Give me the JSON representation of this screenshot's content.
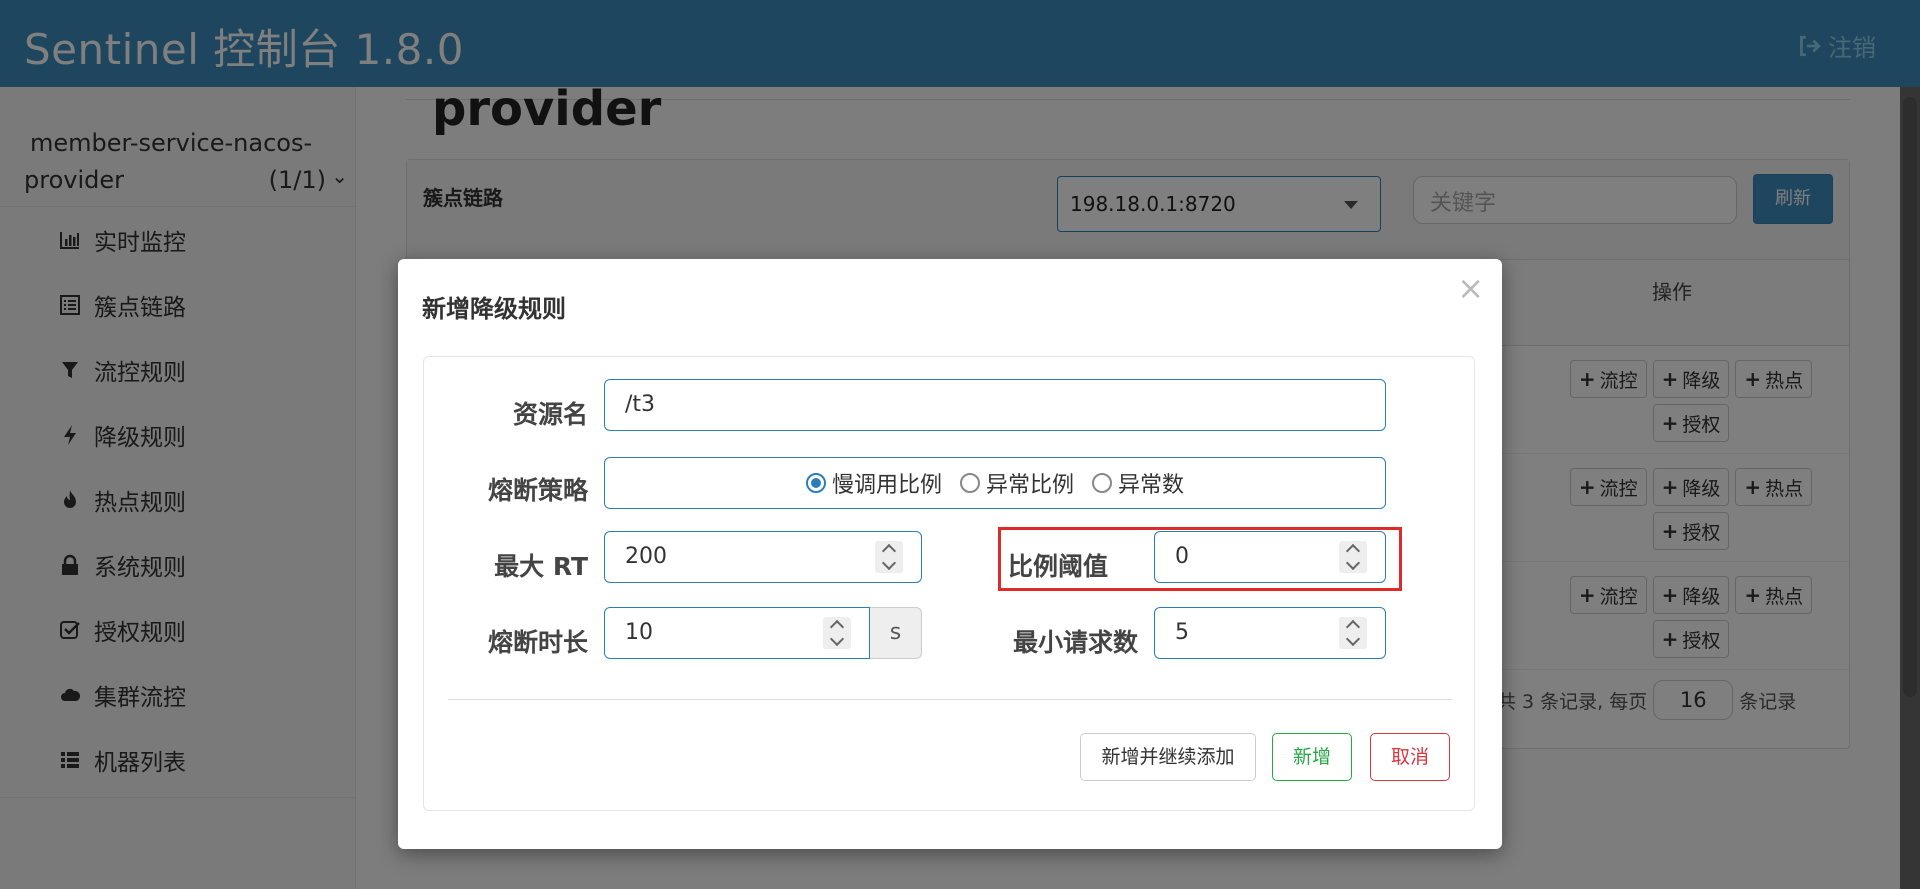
{
  "header": {
    "brand": "Sentinel 控制台 1.8.0",
    "logout_label": "注销",
    "color": "#3c8dbc"
  },
  "sidebar": {
    "app_name_line1": "member-service-nacos-",
    "app_name_line2": "provider",
    "app_count": "(1/1)",
    "items": [
      {
        "label": "实时监控",
        "icon": "bar-chart-icon"
      },
      {
        "label": "簇点链路",
        "icon": "list-icon"
      },
      {
        "label": "流控规则",
        "icon": "filter-icon"
      },
      {
        "label": "降级规则",
        "icon": "flash-icon"
      },
      {
        "label": "热点规则",
        "icon": "fire-icon"
      },
      {
        "label": "系统规则",
        "icon": "lock-icon"
      },
      {
        "label": "授权规则",
        "icon": "check-square-icon"
      },
      {
        "label": "集群流控",
        "icon": "cloud-icon"
      },
      {
        "label": "机器列表",
        "icon": "th-list-icon"
      }
    ]
  },
  "main": {
    "page_title": "provider",
    "panel_title": "簇点链路",
    "ip_select": "198.18.0.1:8720",
    "keyword_placeholder": "关键字",
    "refresh_label": "刷新",
    "op_header": "操作",
    "row_actions": [
      "流控",
      "降级",
      "热点",
      "授权"
    ],
    "pager_prefix": "共 3 条记录, 每页",
    "page_size": "16",
    "pager_suffix": "条记录"
  },
  "modal": {
    "title": "新增降级规则",
    "close": "×",
    "resource_label": "资源名",
    "resource_value": "/t3",
    "strategy_label": "熔断策略",
    "strategy_options": [
      "慢调用比例",
      "异常比例",
      "异常数"
    ],
    "strategy_selected": "慢调用比例",
    "max_rt_label": "最大 RT",
    "max_rt_value": "200",
    "ratio_label": "比例阈值",
    "ratio_value": "0",
    "duration_label": "熔断时长",
    "duration_value": "10",
    "duration_unit": "s",
    "min_requests_label": "最小请求数",
    "min_requests_value": "5",
    "btn_continue": "新增并继续添加",
    "btn_add": "新增",
    "btn_cancel": "取消"
  }
}
